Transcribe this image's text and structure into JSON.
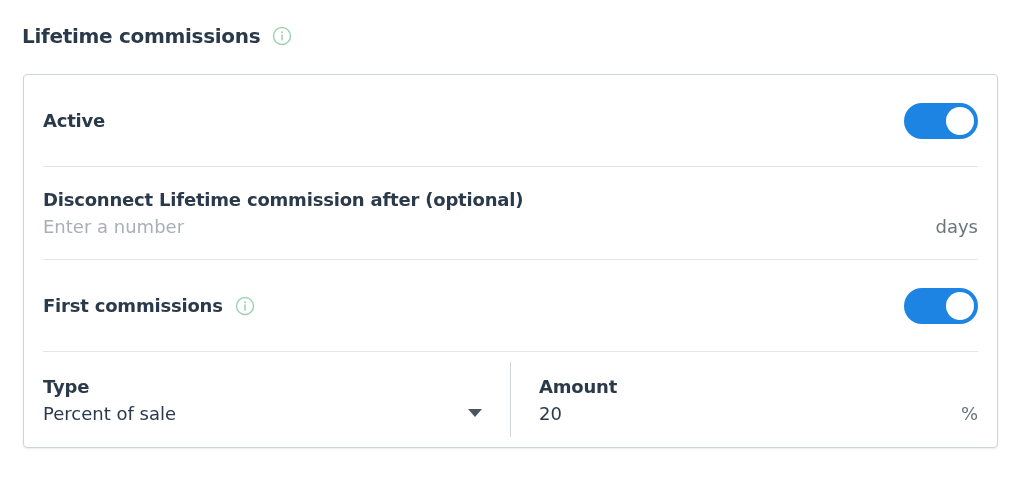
{
  "section": {
    "title": "Lifetime commissions"
  },
  "settings": {
    "active": {
      "label": "Active",
      "on": true
    },
    "disconnect": {
      "label": "Disconnect Lifetime commission after (optional)",
      "placeholder": "Enter a number",
      "unit": "days"
    },
    "first_commissions": {
      "label": "First commissions",
      "on": true
    },
    "type": {
      "label": "Type",
      "value": "Percent of sale"
    },
    "amount": {
      "label": "Amount",
      "value": "20",
      "unit": "%"
    }
  }
}
